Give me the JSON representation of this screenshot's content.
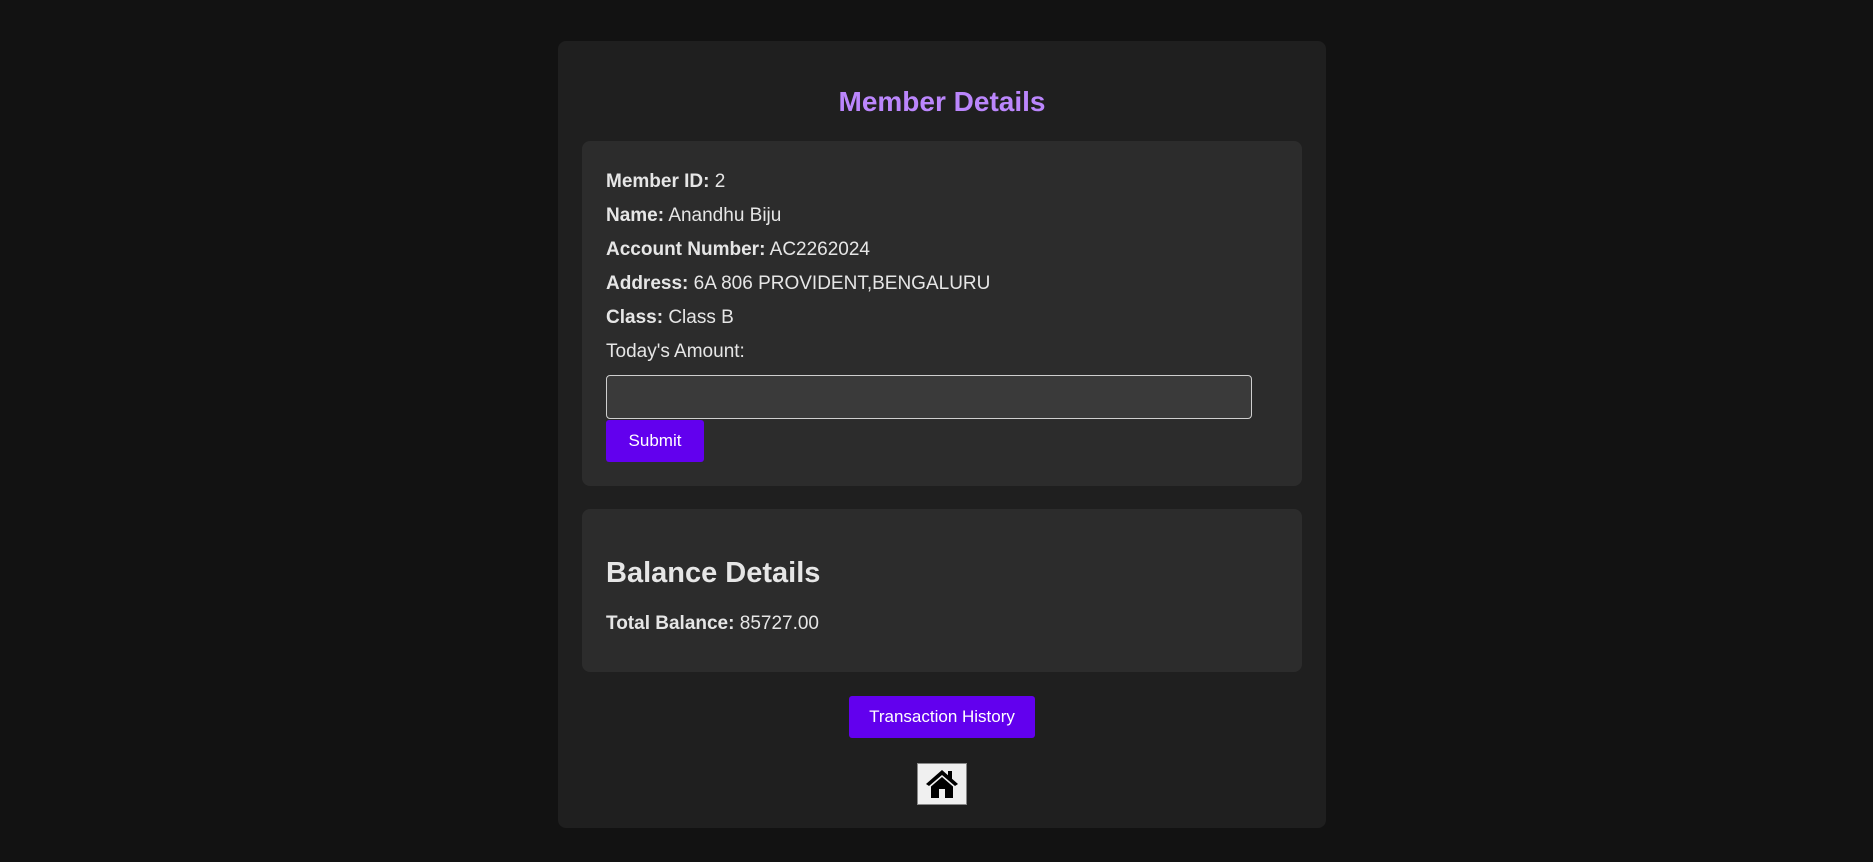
{
  "member": {
    "title": "Member Details",
    "fields": [
      {
        "label": "Member ID:",
        "value": "2"
      },
      {
        "label": "Name:",
        "value": "Anandhu Biju"
      },
      {
        "label": "Account Number:",
        "value": "AC2262024"
      },
      {
        "label": "Address:",
        "value": "6A 806 PROVIDENT,BENGALURU"
      },
      {
        "label": "Class:",
        "value": "Class B"
      }
    ],
    "amount_label": "Today's Amount:",
    "amount_value": "",
    "submit_label": "Submit"
  },
  "balance": {
    "title": "Balance Details",
    "total_label": "Total Balance:",
    "total_value": "85727.00"
  },
  "actions": {
    "history_label": "Transaction History",
    "home_icon": "home-icon"
  },
  "colors": {
    "background": "#121212",
    "container": "#1f1f1f",
    "card": "#2c2c2c",
    "accent": "#bb86fc",
    "button": "#6200ee"
  }
}
